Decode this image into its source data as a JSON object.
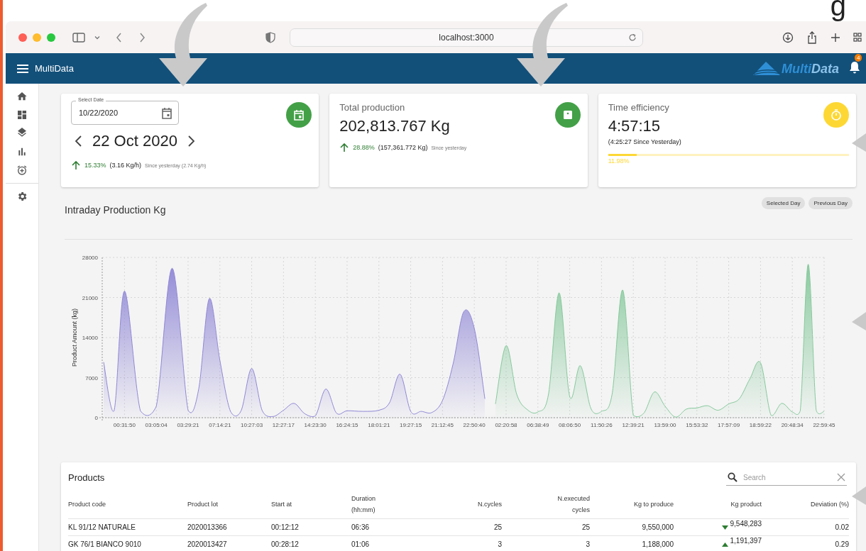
{
  "overlay": {
    "heading_fragment": "g"
  },
  "browser": {
    "url": "localhost:3000"
  },
  "app_bar": {
    "title": "MultiData",
    "logo": [
      "Multi",
      "Data"
    ],
    "notification_count": "4"
  },
  "date_card": {
    "field_label": "Select Date",
    "field_value": "10/22/2020",
    "date": "22 Oct 2020",
    "change": "15.33%",
    "rate": "(3.16 Kg/h)",
    "comparison": "Since yesterday (2.74 Kg/h)"
  },
  "production_card": {
    "title": "Total production",
    "value": "202,813.767 Kg",
    "change": "28.88%",
    "amount": "(157,361.772 Kg)",
    "comparison": "Since yesterday"
  },
  "efficiency_card": {
    "title": "Time efficiency",
    "value": "4:57:15",
    "comparison": "(4:25:27 Since Yesterday)",
    "level": 0.12,
    "percent": "11.98%"
  },
  "chart_section": {
    "title": "Intraday Production Kg",
    "buttons": [
      "Selected Day",
      "Previous Day"
    ],
    "chart_data": {
      "type": "area",
      "ylabel": "Product Amount (kg)",
      "categories": [
        null,
        null,
        "00:31:50",
        null,
        "03:05:04",
        null,
        "03:29:21",
        null,
        null,
        "07:14:21",
        null,
        null,
        "10:27:03",
        null,
        null,
        "12:27:17",
        null,
        null,
        "14:23:30",
        null,
        null,
        "16:24:15",
        null,
        "18:01:21",
        null,
        null,
        "19:27:15",
        null,
        null,
        "21:12:45",
        null,
        null,
        "22:50:40",
        null,
        null,
        "02:20:58",
        null,
        null,
        "06:38:49",
        null,
        null,
        "08:06:50",
        null,
        null,
        "11:50:26",
        null,
        null,
        "12:39:21",
        null,
        null,
        "13:59:00",
        null,
        null,
        "15:53:32",
        null,
        null,
        "17:57:09",
        null,
        null,
        "18:59:22",
        null,
        null,
        "20:48:34",
        null,
        null,
        null,
        "22:59:45"
      ],
      "series": [
        {
          "color": "#9088d6",
          "values": [
            9700,
            1200,
            22100,
            1200,
            2000,
            26100,
            1300,
            5000,
            20800,
            10000,
            1100,
            1200,
            8600,
            1200,
            200,
            1300,
            2500,
            700,
            300,
            5000,
            800,
            1200,
            1100,
            1300,
            2600,
            7600,
            1100,
            1100,
            900,
            3000,
            9400,
            18500,
            15600,
            3300,
            null,
            null,
            null,
            null,
            null,
            null,
            null,
            null,
            null,
            null,
            null,
            null,
            null,
            null,
            null,
            null,
            null,
            null,
            null,
            null,
            null,
            null,
            null,
            null,
            null,
            null,
            null,
            null,
            null,
            null,
            null,
            null,
            null
          ]
        },
        {
          "color": "#86c99c",
          "values": [
            null,
            null,
            null,
            null,
            null,
            null,
            null,
            null,
            null,
            null,
            null,
            null,
            null,
            null,
            null,
            null,
            null,
            null,
            null,
            null,
            null,
            null,
            null,
            null,
            null,
            null,
            null,
            null,
            null,
            null,
            null,
            null,
            null,
            null,
            2400,
            12600,
            4100,
            1400,
            1000,
            4100,
            21800,
            3700,
            9100,
            1600,
            1100,
            4100,
            22300,
            400,
            800,
            4500,
            2000,
            100,
            1500,
            1700,
            2100,
            1300,
            2400,
            3300,
            6800,
            9600,
            400,
            2500,
            1000,
            1200,
            26800,
            1300,
            1100
          ]
        }
      ],
      "grid": true,
      "ylim": [
        0,
        28000
      ],
      "yticks": [
        0,
        7000,
        14000,
        21000,
        28000
      ]
    }
  },
  "products": {
    "title": "Products",
    "search": {
      "placeholder": "Search"
    },
    "columns": [
      "Product code",
      "Product lot",
      "Start at",
      "Duration\n(hh:mm)",
      "N.cycles",
      "N.executed\ncycles",
      "Kg to produce",
      "Kg product",
      "Deviation (%)"
    ],
    "rows": [
      {
        "code": "KL 91/12 NATURALE",
        "lot": "2020013366",
        "start": "00:12:12",
        "duration": "06:36",
        "cycles": "25",
        "executed": "25",
        "to_produce": "9,550,000",
        "rising": false,
        "product": "9,548,283",
        "deviation": "0.02"
      },
      {
        "code": "GK 76/1 BIANCO 9010",
        "lot": "2020013427",
        "start": "00:28:12",
        "duration": "01:06",
        "cycles": "3",
        "executed": "3",
        "to_produce": "1,188,000",
        "rising": true,
        "product": "1,191,397",
        "deviation": "0.29"
      }
    ]
  }
}
